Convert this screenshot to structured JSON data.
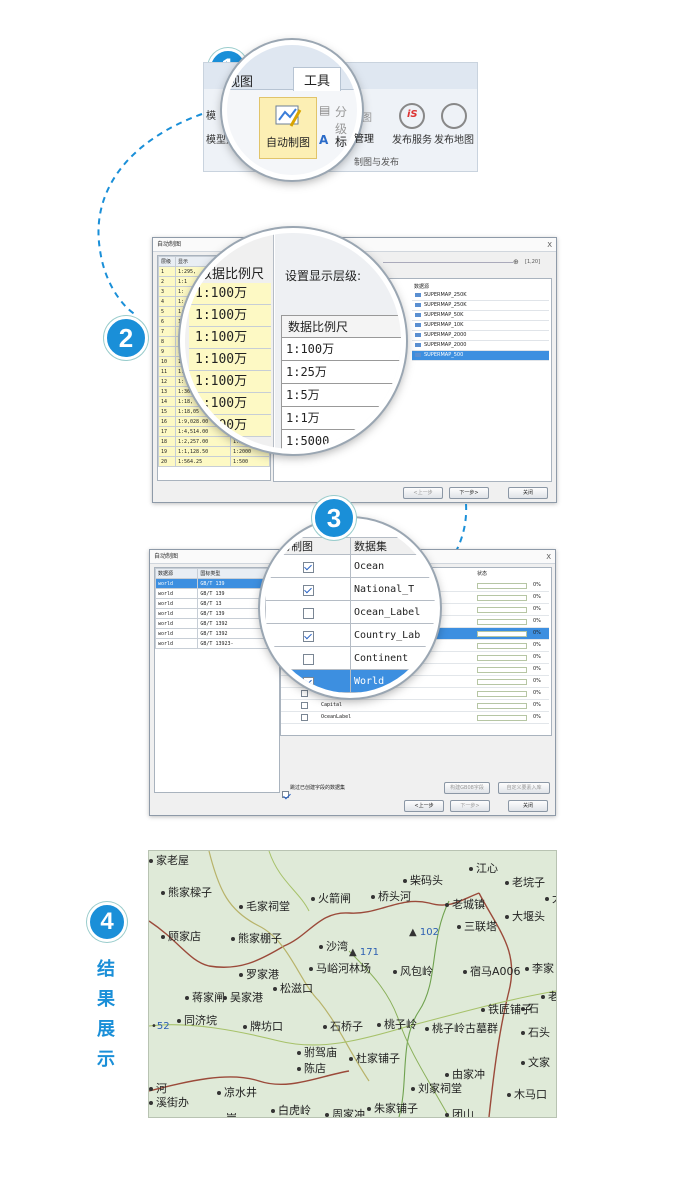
{
  "steps": {
    "s1": "1",
    "s2": "2",
    "s3": "3",
    "s4": "4"
  },
  "result_label_chars": [
    "结",
    "果",
    "展",
    "示"
  ],
  "ribbon": {
    "tab_view": "视图",
    "tab_tools": "工具",
    "partial_left_1": "模",
    "partial_left_2": "模型升级",
    "auto_map_label": "自动制图",
    "split_label": "分级",
    "label_manage_prefix": "标",
    "label_manage_suffix": "管理",
    "partial_map": "图",
    "publish_service_label": "发布服务",
    "publish_map_label": "发布地图",
    "group_label": "制图与发布"
  },
  "dialog1": {
    "title": "自动制图",
    "close": "X",
    "col_level": "层级",
    "col_display": "显示",
    "rows": [
      {
        "level": "1",
        "display": "1:295,"
      },
      {
        "level": "2",
        "display": "1:1"
      },
      {
        "level": "3",
        "display": "1:"
      },
      {
        "level": "4",
        "display": "1:"
      },
      {
        "level": "5",
        "display": "1:"
      },
      {
        "level": "6",
        "display": "1:"
      },
      {
        "level": "7",
        "display": "1:"
      },
      {
        "level": "8",
        "display": "1:"
      },
      {
        "level": "9",
        "display": "1:"
      },
      {
        "level": "10",
        "display": "1:"
      },
      {
        "level": "11",
        "display": "1:"
      },
      {
        "level": "12",
        "display": "1:"
      },
      {
        "level": "13",
        "display": "1:36,"
      },
      {
        "level": "14",
        "display": "1:18,"
      },
      {
        "level": "15",
        "display": "1:18,05"
      },
      {
        "level": "16",
        "display": "1:9,028.00"
      },
      {
        "level": "17",
        "display": "1:4,514.00"
      },
      {
        "level": "18",
        "display": "1:2,257.00"
      },
      {
        "level": "19",
        "display": "1:1,128.50"
      },
      {
        "level": "20",
        "display": "1:564.25"
      }
    ],
    "tail_scales": [
      "1:5000",
      "1:2000",
      "1:2000",
      "1:500"
    ],
    "slider_value": "[1,20]",
    "col_dataset": "数据源",
    "datasets": [
      "SUPERMAP_250K",
      "SUPERMAP_250K",
      "SUPERMAP_50K",
      "SUPERMAP_10K",
      "SUPERMAP_2000",
      "SUPERMAP_2000",
      "SUPERMAP_500"
    ],
    "btn_prev": "<上一步",
    "btn_next": "下一步>",
    "btn_close": "关闭"
  },
  "mag2": {
    "col_scale": "数据比例尺",
    "rows": [
      "1:100万",
      "1:100万",
      "1:100万",
      "1:100万",
      "1:100万",
      "1:100万",
      "1:100万"
    ],
    "setting_label": "设置显示层级:",
    "col_scale_2": "数据比例尺",
    "rows2": [
      "1:100万",
      "1:25万",
      "1:5万",
      "1:1万",
      "1:5000"
    ]
  },
  "dialog2": {
    "title": "自动制图",
    "close": "X",
    "col_datasource": "数据源",
    "col_standard": "国标类型",
    "sources": [
      {
        "name": "world",
        "std": "GB/T 139"
      },
      {
        "name": "world",
        "std": "GB/T 139"
      },
      {
        "name": "world",
        "std": "GB/T 13"
      },
      {
        "name": "world",
        "std": "GB/T 139"
      },
      {
        "name": "world",
        "std": "GB/T 1392"
      },
      {
        "name": "world",
        "std": "GB/T 1392"
      },
      {
        "name": "world",
        "std": "GB/T 13923-"
      }
    ],
    "col_field": "字段",
    "col_status": "状态",
    "right_rows": [
      {
        "name": "",
        "pct": "0%"
      },
      {
        "name": "",
        "pct": "0%"
      },
      {
        "name": "",
        "pct": "0%"
      },
      {
        "name": "",
        "pct": "0%"
      },
      {
        "name": "",
        "pct": "0%"
      },
      {
        "name": "",
        "pct": "0%"
      },
      {
        "name": "",
        "pct": "0%"
      },
      {
        "name": "",
        "pct": "0%"
      },
      {
        "name": "",
        "pct": "0%"
      },
      {
        "name": "Frame",
        "pct": "0%"
      },
      {
        "name": "Capital",
        "pct": "0%"
      },
      {
        "name": "OceanLabel",
        "pct": "0%"
      }
    ],
    "skip_label": "跳过已创建字段的数据集",
    "btn_build": "构建GB08字段",
    "btn_custom": "自定义要素入库",
    "btn_prev": "<上一步",
    "btn_next": "下一步>",
    "btn_close": "关闭"
  },
  "mag3": {
    "col_participate": "参与制图",
    "col_dataset": "数据集",
    "rows": [
      {
        "name": "Ocean",
        "checked": true
      },
      {
        "name": "National_T",
        "checked": true
      },
      {
        "name": "Ocean_Label",
        "checked": false
      },
      {
        "name": "Country_Lab",
        "checked": true
      },
      {
        "name": "Continent",
        "checked": false
      },
      {
        "name": "World",
        "checked": true
      }
    ]
  },
  "map": {
    "places": [
      "家老屋",
      "熊家樑子",
      "毛家祠堂",
      "火箭闸",
      "柴码头",
      "江心",
      "老垸子",
      "大",
      "桥头河",
      "老城镇",
      "三联塔",
      "大堰头",
      "顾家店",
      "熊家棚子",
      "沙湾",
      "马峪河林场",
      "风包岭",
      "宿马A006",
      "李家",
      "罗家港",
      "松滋口",
      "老",
      "蒋家闸",
      "吴家港",
      "铁匠铺子",
      "石",
      "同济垸",
      "牌坊口",
      "石桥子",
      "桃子岭",
      "桃子岭古墓群",
      "石头",
      "驸驾庙",
      "陈店",
      "杜家铺子",
      "文家",
      "由家冲",
      "凉水井",
      "刘家祠堂",
      "木马口",
      "白虎岭",
      "周家冲",
      "朱家铺子",
      "团山",
      "溪街办",
      "河",
      "岗"
    ],
    "elevations": [
      "171",
      "102",
      "52"
    ]
  }
}
